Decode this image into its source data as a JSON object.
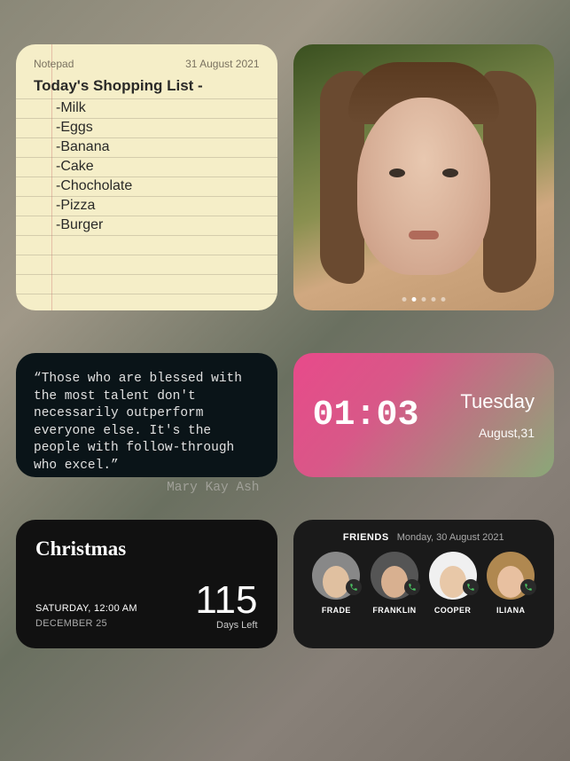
{
  "notepad": {
    "label": "Notepad",
    "date": "31 August 2021",
    "title": "Today's Shopping List -",
    "items": [
      "Milk",
      "Eggs",
      "Banana",
      "Cake",
      "Chocholate",
      "Pizza",
      "Burger"
    ]
  },
  "photo": {
    "pager_count": 5,
    "pager_active": 1
  },
  "quote": {
    "text": "“Those who are blessed with the most talent don't necessarily outperform everyone else. It's the people with follow-through who excel.”",
    "author": "Mary Kay Ash"
  },
  "clock": {
    "time": "01:03",
    "day": "Tuesday",
    "date": "August,31"
  },
  "countdown": {
    "event": "Christmas",
    "line1": "SATURDAY, 12:00 AM",
    "line2": "DECEMBER 25",
    "days": "115",
    "days_label": "Days Left"
  },
  "friendsWidget": {
    "title": "FRIENDS",
    "date": "Monday, 30 August 2021",
    "friends": [
      {
        "name": "FRADE",
        "skin": "#e0c0a0",
        "bg": "#888"
      },
      {
        "name": "FRANKLIN",
        "skin": "#d8b090",
        "bg": "#555"
      },
      {
        "name": "COOPER",
        "skin": "#e8c8a8",
        "bg": "#f0f0f0"
      },
      {
        "name": "ILIANA",
        "skin": "#e8c0a0",
        "bg": "#b08850"
      }
    ]
  }
}
